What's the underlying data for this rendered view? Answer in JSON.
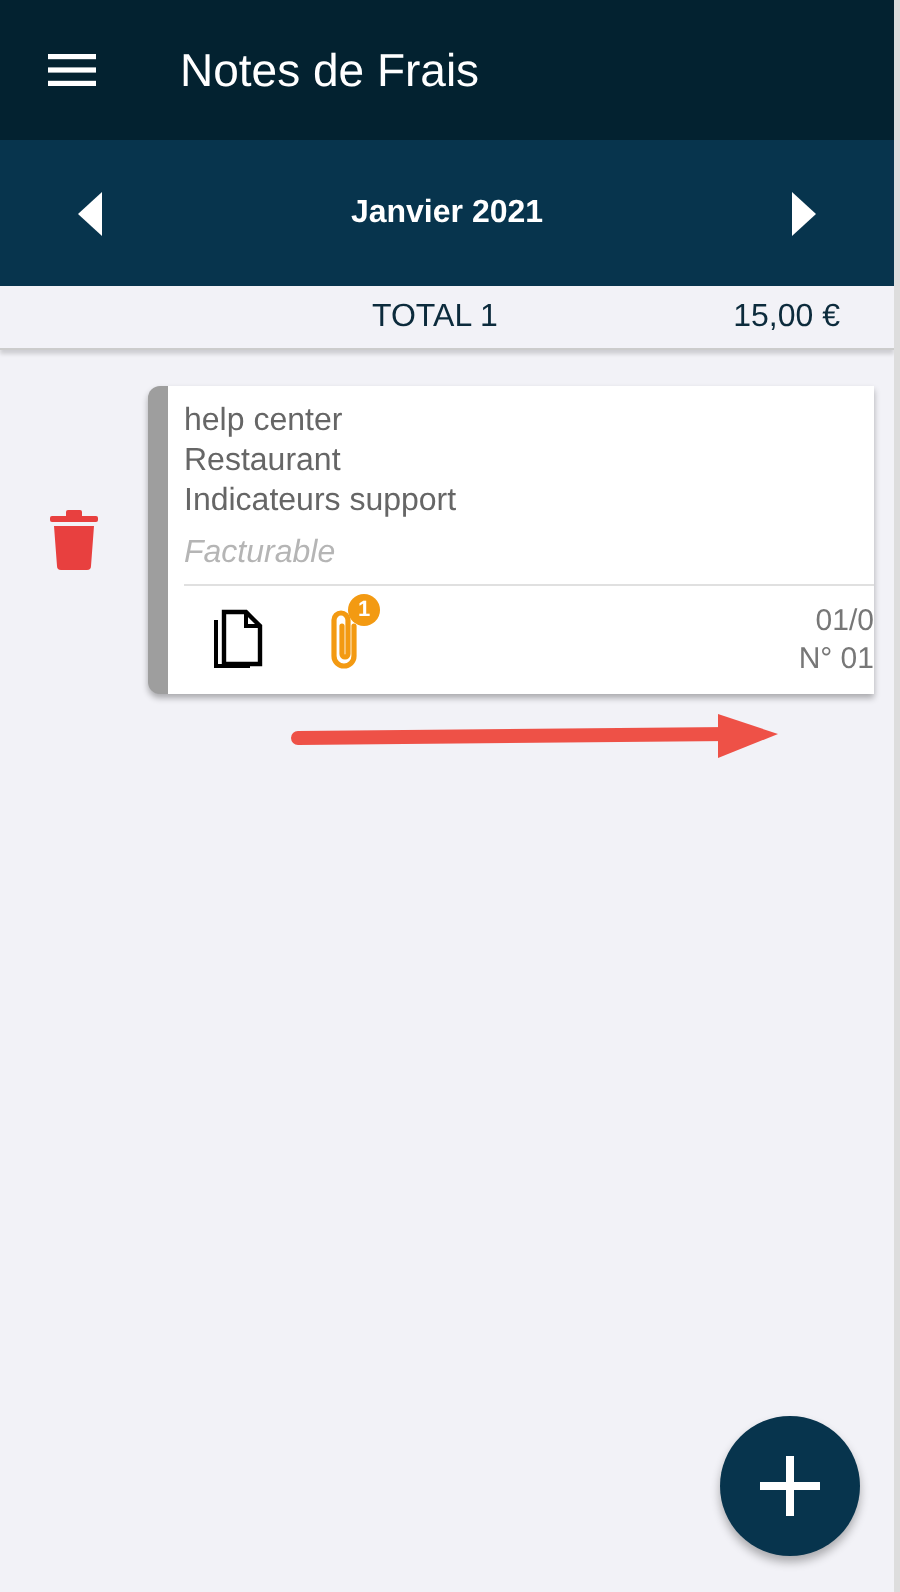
{
  "app_bar": {
    "title": "Notes de Frais"
  },
  "month_bar": {
    "label": "Janvier 2021"
  },
  "summary": {
    "label": "TOTAL 1",
    "amount": "15,00 €"
  },
  "expenses": [
    {
      "client": "help center",
      "category": "Restaurant",
      "description": "Indicateurs support",
      "billing": "Facturable",
      "attachments": "1",
      "date": "01/0",
      "number": "N° 01"
    }
  ]
}
